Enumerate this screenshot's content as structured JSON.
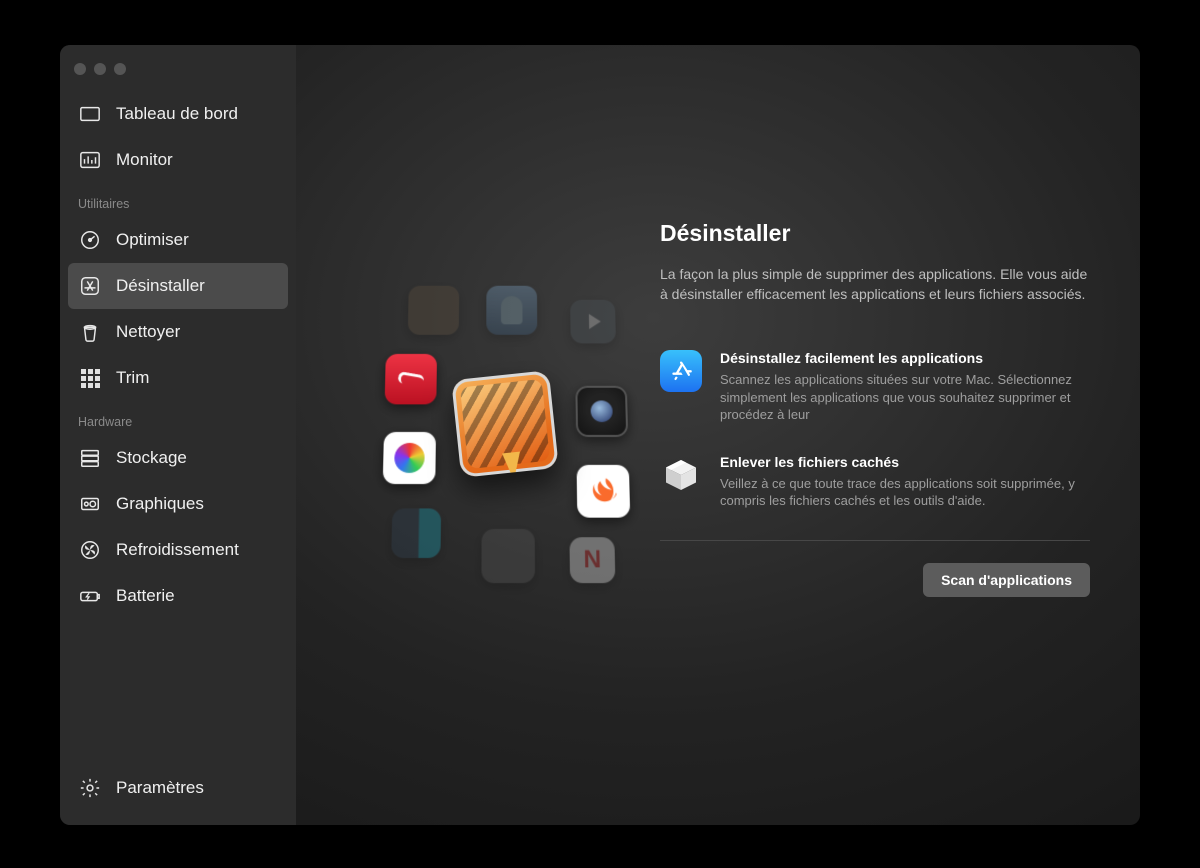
{
  "sidebar": {
    "top": [
      {
        "id": "dashboard",
        "label": "Tableau de bord"
      },
      {
        "id": "monitor",
        "label": "Monitor"
      }
    ],
    "section_utils": "Utilitaires",
    "utils": [
      {
        "id": "optimize",
        "label": "Optimiser"
      },
      {
        "id": "uninstall",
        "label": "Désinstaller",
        "selected": true
      },
      {
        "id": "clean",
        "label": "Nettoyer"
      },
      {
        "id": "trim",
        "label": "Trim"
      }
    ],
    "section_hw": "Hardware",
    "hw": [
      {
        "id": "storage",
        "label": "Stockage"
      },
      {
        "id": "graphics",
        "label": "Graphiques"
      },
      {
        "id": "cooling",
        "label": "Refroidissement"
      },
      {
        "id": "battery",
        "label": "Batterie"
      }
    ],
    "settings_label": "Paramètres"
  },
  "main": {
    "title": "Désinstaller",
    "description": "La façon la plus simple de supprimer des applications. Elle vous aide à désinstaller efficacement les applications et leurs fichiers associés.",
    "features": [
      {
        "title": "Désinstallez facilement les applications",
        "body": "Scannez les applications situées sur votre Mac. Sélectionnez simplement les applications que vous souhaitez supprimer et procédez à leur"
      },
      {
        "title": "Enlever les fichiers cachés",
        "body": "Veillez à ce que toute trace des applications soit supprimée, y compris les fichiers cachés et les outils d'aide."
      }
    ],
    "scan_button": "Scan d'applications"
  }
}
